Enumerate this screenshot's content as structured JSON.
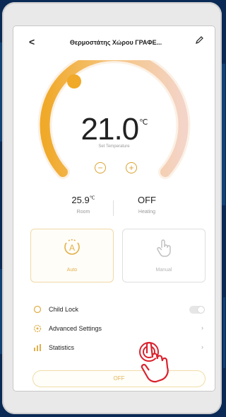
{
  "header": {
    "back_icon": "chevron-left-icon",
    "title": "Θερμοστάτης Χώρου ΓΡΑΦΕ...",
    "edit_icon": "pencil-icon"
  },
  "gauge": {
    "set_temperature": "21.0",
    "unit": "℃",
    "set_label": "Set Temperature",
    "minus_label": "−",
    "plus_label": "+",
    "colors": {
      "warm": "#f0a928",
      "fade": "#f4d4c8",
      "track": "#fbf1e6"
    }
  },
  "stats": {
    "room_value": "25.9",
    "room_unit": "℃",
    "room_label": "Room",
    "heating_value": "OFF",
    "heating_label": "Heating"
  },
  "modes": {
    "auto_label": "Auto",
    "manual_label": "Manual",
    "auto_icon": "auto-mode-icon",
    "manual_icon": "hand-pointer-icon"
  },
  "menu": {
    "child_lock_label": "Child Lock",
    "child_lock_on": false,
    "advanced_settings_label": "Advanced Settings",
    "statistics_label": "Statistics"
  },
  "power": {
    "off_label": "OFF"
  },
  "overlay": {
    "tap_hand_icon": "tap-hand-icon",
    "color": "#d9232e"
  }
}
